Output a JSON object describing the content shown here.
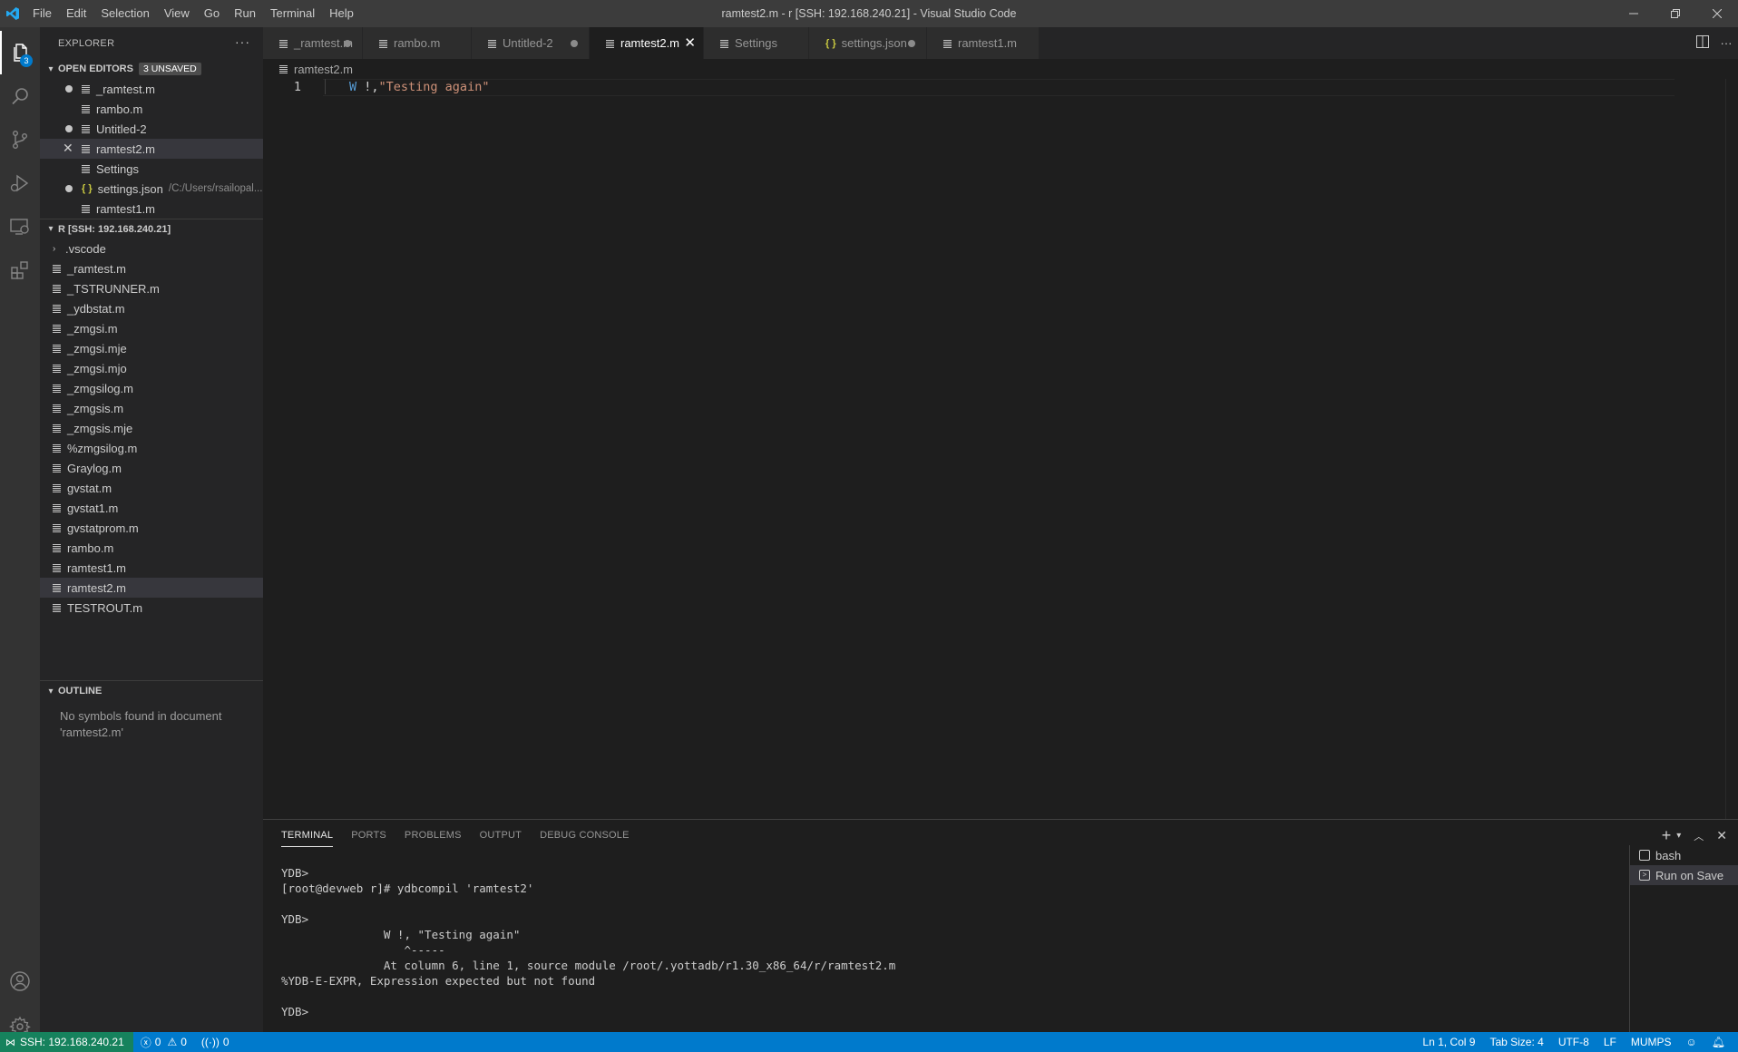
{
  "window": {
    "title": "ramtest2.m - r [SSH: 192.168.240.21] - Visual Studio Code",
    "menu": [
      "File",
      "Edit",
      "Selection",
      "View",
      "Go",
      "Run",
      "Terminal",
      "Help"
    ]
  },
  "activity_bar": {
    "explorer_badge": "3"
  },
  "sidebar": {
    "header": "EXPLORER",
    "more": "···",
    "open_editors": {
      "title": "OPEN EDITORS",
      "badge": "3 UNSAVED",
      "items": [
        {
          "name": "_ramtest.m",
          "state": "dirty"
        },
        {
          "name": "rambo.m",
          "state": "clean"
        },
        {
          "name": "Untitled-2",
          "state": "dirty"
        },
        {
          "name": "ramtest2.m",
          "state": "active"
        },
        {
          "name": "Settings",
          "state": "clean"
        },
        {
          "name": "settings.json",
          "state": "dirty",
          "path": "/C:/Users/rsailopal..."
        },
        {
          "name": "ramtest1.m",
          "state": "clean"
        }
      ]
    },
    "folder": {
      "title": "R [SSH: 192.168.240.21]",
      "subfolder": ".vscode",
      "files": [
        "_ramtest.m",
        "_TSTRUNNER.m",
        "_ydbstat.m",
        "_zmgsi.m",
        "_zmgsi.mje",
        "_zmgsi.mjo",
        "_zmgsilog.m",
        "_zmgsis.m",
        "_zmgsis.mje",
        "%zmgsilog.m",
        "Graylog.m",
        "gvstat.m",
        "gvstat1.m",
        "gvstatprom.m",
        "rambo.m",
        "ramtest1.m",
        "ramtest2.m",
        "TESTROUT.m"
      ],
      "selected": "ramtest2.m"
    },
    "outline": {
      "title": "OUTLINE",
      "message_line1": "No symbols found in document",
      "message_line2": "'ramtest2.m'"
    }
  },
  "tabs": [
    {
      "label": "_ramtest.m",
      "dirty": true
    },
    {
      "label": "rambo.m",
      "dirty": false
    },
    {
      "label": "Untitled-2",
      "dirty": true
    },
    {
      "label": "ramtest2.m",
      "active": true
    },
    {
      "label": "Settings",
      "dirty": false
    },
    {
      "label": "settings.json",
      "dirty": true,
      "json": true
    },
    {
      "label": "ramtest1.m",
      "dirty": false
    }
  ],
  "editor": {
    "breadcrumb": "ramtest2.m",
    "line_number": "1",
    "code_keyword": "W",
    "code_op": " !,",
    "code_string": "\"Testing again\""
  },
  "panel": {
    "tabs": [
      "TERMINAL",
      "PORTS",
      "PROBLEMS",
      "OUTPUT",
      "DEBUG CONSOLE"
    ],
    "terminal_lines": [
      "YDB>",
      "[root@devweb r]# ydbcompil 'ramtest2'",
      "",
      "YDB>",
      "               W !, \"Testing again\"",
      "                  ^-----",
      "               At column 6, line 1, source module /root/.yottadb/r1.30_x86_64/r/ramtest2.m",
      "%YDB-E-EXPR, Expression expected but not found",
      "",
      "YDB>"
    ],
    "terminal_list": [
      "bash",
      "Run on Save"
    ]
  },
  "statusbar": {
    "remote": "SSH: 192.168.240.21",
    "errors": "0",
    "warnings": "0",
    "ports": "0",
    "position": "Ln 1, Col 9",
    "tab_size": "Tab Size: 4",
    "encoding": "UTF-8",
    "eol": "LF",
    "language": "MUMPS"
  },
  "colors": {
    "accent": "#007acc",
    "remote": "#16825d"
  }
}
